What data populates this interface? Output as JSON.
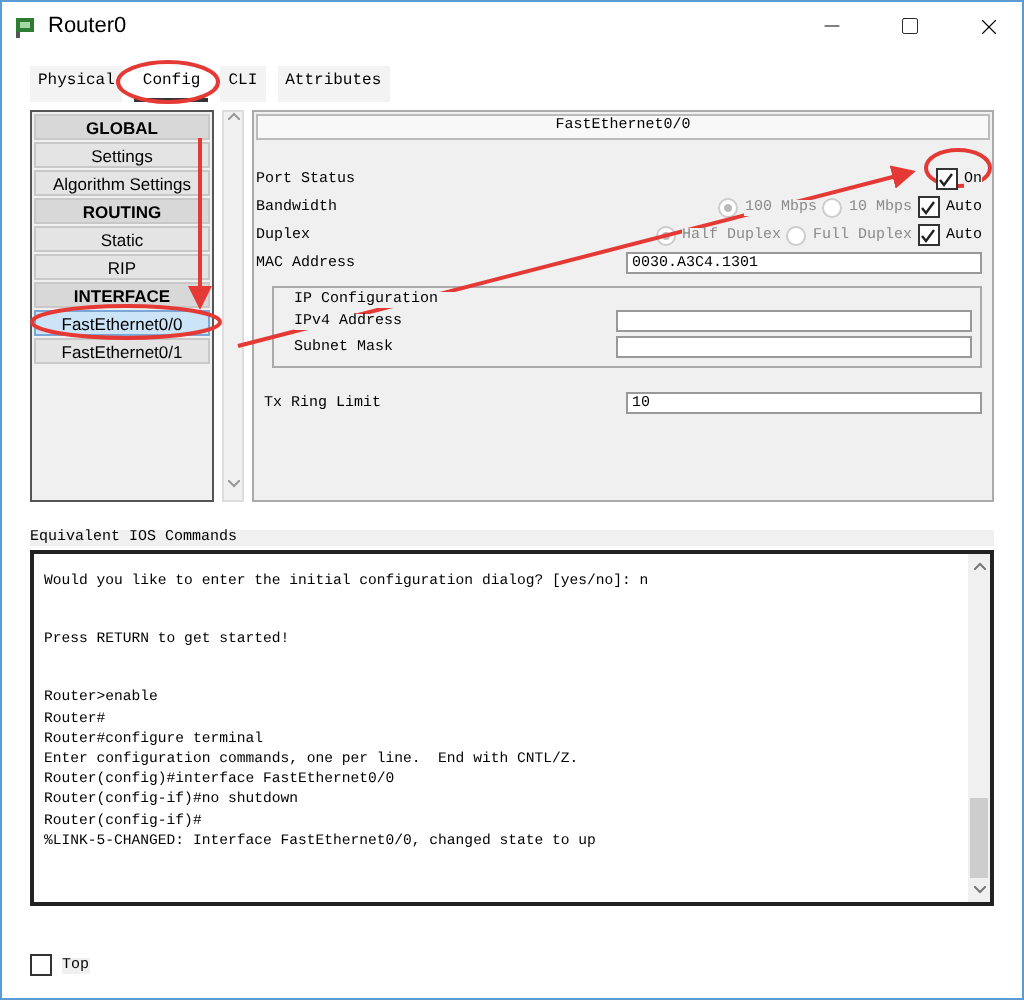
{
  "window": {
    "title": "Router0"
  },
  "tabs": [
    {
      "label": "Physical",
      "selected": false
    },
    {
      "label": "Config",
      "selected": true
    },
    {
      "label": "CLI",
      "selected": false
    },
    {
      "label": "Attributes",
      "selected": false
    }
  ],
  "sidebar": {
    "items": [
      {
        "kind": "header",
        "label": "GLOBAL",
        "selected": false
      },
      {
        "kind": "item",
        "label": "Settings",
        "selected": false
      },
      {
        "kind": "item",
        "label": "Algorithm Settings",
        "selected": false
      },
      {
        "kind": "header",
        "label": "ROUTING",
        "selected": false
      },
      {
        "kind": "item",
        "label": "Static",
        "selected": false
      },
      {
        "kind": "item",
        "label": "RIP",
        "selected": false
      },
      {
        "kind": "header",
        "label": "INTERFACE",
        "selected": false
      },
      {
        "kind": "item",
        "label": "FastEthernet0/0",
        "selected": true
      },
      {
        "kind": "item",
        "label": "FastEthernet0/1",
        "selected": false
      }
    ]
  },
  "panel": {
    "title": "FastEthernet0/0",
    "port_status": {
      "label": "Port Status",
      "checkbox": {
        "label": "On",
        "checked": true
      }
    },
    "bandwidth": {
      "label": "Bandwidth",
      "options": [
        {
          "label": "100 Mbps",
          "selected": true
        },
        {
          "label": "10 Mbps",
          "selected": false
        }
      ],
      "disabled": true,
      "auto": {
        "label": "Auto",
        "checked": true
      }
    },
    "duplex": {
      "label": "Duplex",
      "options": [
        {
          "label": "Half Duplex",
          "selected": true
        },
        {
          "label": "Full Duplex",
          "selected": false
        }
      ],
      "disabled": true,
      "auto": {
        "label": "Auto",
        "checked": true
      }
    },
    "mac_address": {
      "label": "MAC Address",
      "value": "0030.A3C4.1301"
    },
    "ip_configuration": {
      "title": "IP Configuration",
      "ipv4_label": "IPv4 Address",
      "subnet_label": "Subnet Mask"
    },
    "tx_ring_limit": {
      "label": "Tx Ring Limit",
      "value": "10"
    }
  },
  "ios_commands": {
    "label": "Equivalent IOS Commands",
    "paragraphs": [
      [
        "Would you like to enter the initial configuration dialog? [yes/no]: n"
      ],
      [
        "Press RETURN to get started!"
      ],
      [
        "Router>enable",
        "Router#",
        "Router#configure terminal",
        "Enter configuration commands, one per line.  End with CNTL/Z.",
        "Router(config)#interface FastEthernet0/0",
        "Router(config-if)#no shutdown",
        "Router(config-if)#",
        "%LINK-5-CHANGED: Interface FastEthernet0/0, changed state to up"
      ]
    ]
  },
  "top_checkbox": {
    "label": "Top",
    "checked": false
  }
}
